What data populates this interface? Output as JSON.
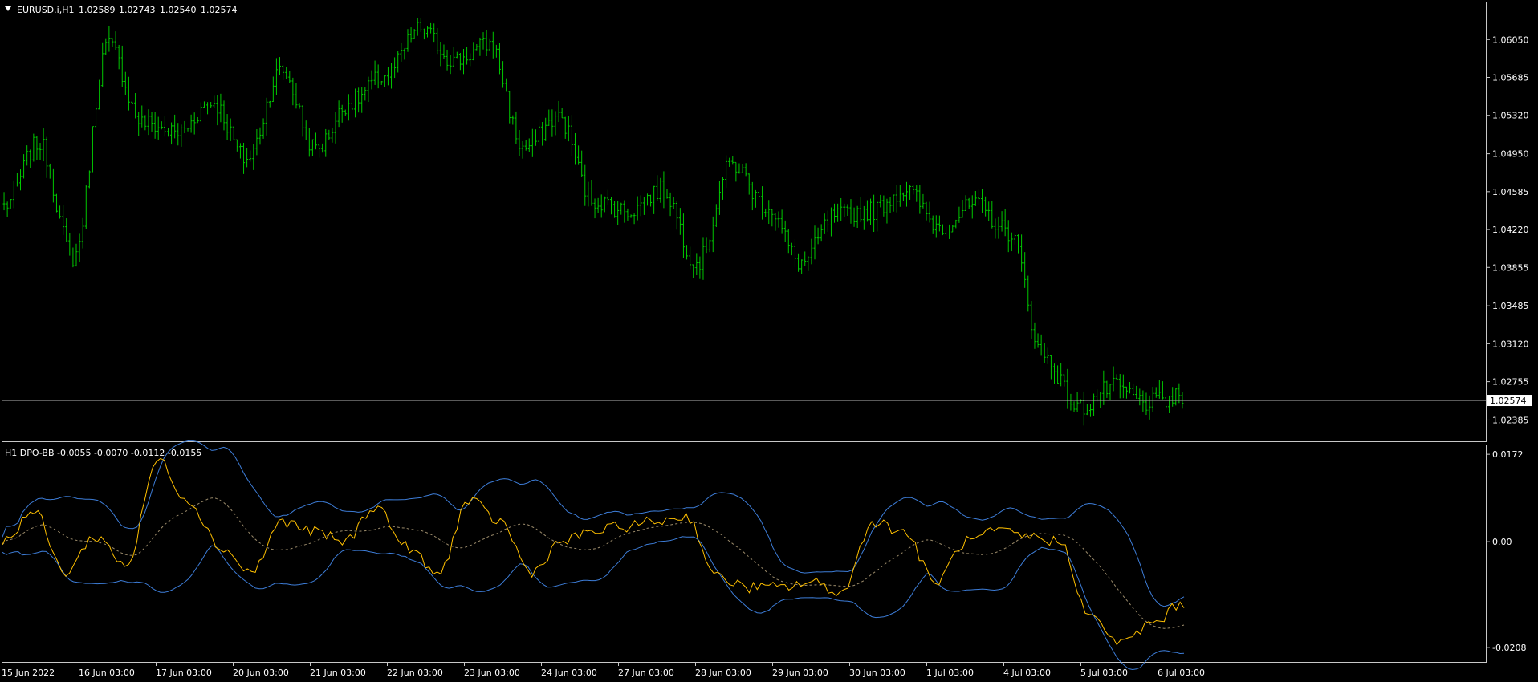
{
  "main_chart": {
    "symbol": "EURUSD.i,H1",
    "open": "1.02589",
    "high": "1.02743",
    "low": "1.02540",
    "close": "1.02574",
    "current_price_label": "1.02574",
    "current_price": 1.02574,
    "price_range": [
      1.0218,
      1.064
    ],
    "price_ticks": [
      "1.06050",
      "1.05685",
      "1.05320",
      "1.04950",
      "1.04585",
      "1.04220",
      "1.03855",
      "1.03485",
      "1.03120",
      "1.02755",
      "1.02385"
    ],
    "bar_color": "#00c800",
    "key_closes": [
      1.0445,
      1.0505,
      1.0395,
      1.06,
      1.0525,
      1.0515,
      1.0545,
      1.049,
      1.0575,
      1.05,
      1.0545,
      1.057,
      1.0615,
      1.0585,
      1.06,
      1.05,
      1.053,
      1.045,
      1.044,
      1.046,
      1.039,
      1.0485,
      1.0445,
      1.039,
      1.0435,
      1.044,
      1.046,
      1.0425,
      1.0445,
      1.042,
      1.03,
      1.025,
      1.027,
      1.0255,
      1.026
    ]
  },
  "indicator": {
    "label": "H1 DPO-BB -0.0055 -0.0070 -0.0112 -0.0155",
    "range": [
      -0.0235,
      0.0188
    ],
    "ticks": [
      "0.0172",
      "0.00",
      "-0.0208"
    ],
    "colors": {
      "dpo": "#ffc000",
      "bands": "#3d7dd8",
      "mid": "#9a8a6a"
    },
    "dpo_key": [
      0.0,
      0.006,
      -0.006,
      0.001,
      -0.0045,
      0.016,
      0.008,
      -0.001,
      -0.006,
      0.004,
      0.002,
      0.0,
      0.007,
      -0.001,
      -0.0065,
      0.008,
      0.004,
      -0.006,
      0.0,
      0.002,
      0.003,
      0.004,
      0.005,
      -0.007,
      -0.009,
      -0.009,
      -0.008,
      -0.01,
      0.004,
      0.002,
      -0.008,
      0.0,
      0.002,
      0.001,
      0.0,
      -0.015,
      -0.02,
      -0.016,
      -0.012
    ]
  },
  "time_axis": {
    "labels": [
      "15 Jun 2022",
      "16 Jun 03:00",
      "17 Jun 03:00",
      "20 Jun 03:00",
      "21 Jun 03:00",
      "22 Jun 03:00",
      "23 Jun 03:00",
      "24 Jun 03:00",
      "27 Jun 03:00",
      "28 Jun 03:00",
      "29 Jun 03:00",
      "30 Jun 03:00",
      "1 Jul 03:00",
      "4 Jul 03:00",
      "5 Jul 03:00",
      "6 Jul 03:00"
    ]
  }
}
